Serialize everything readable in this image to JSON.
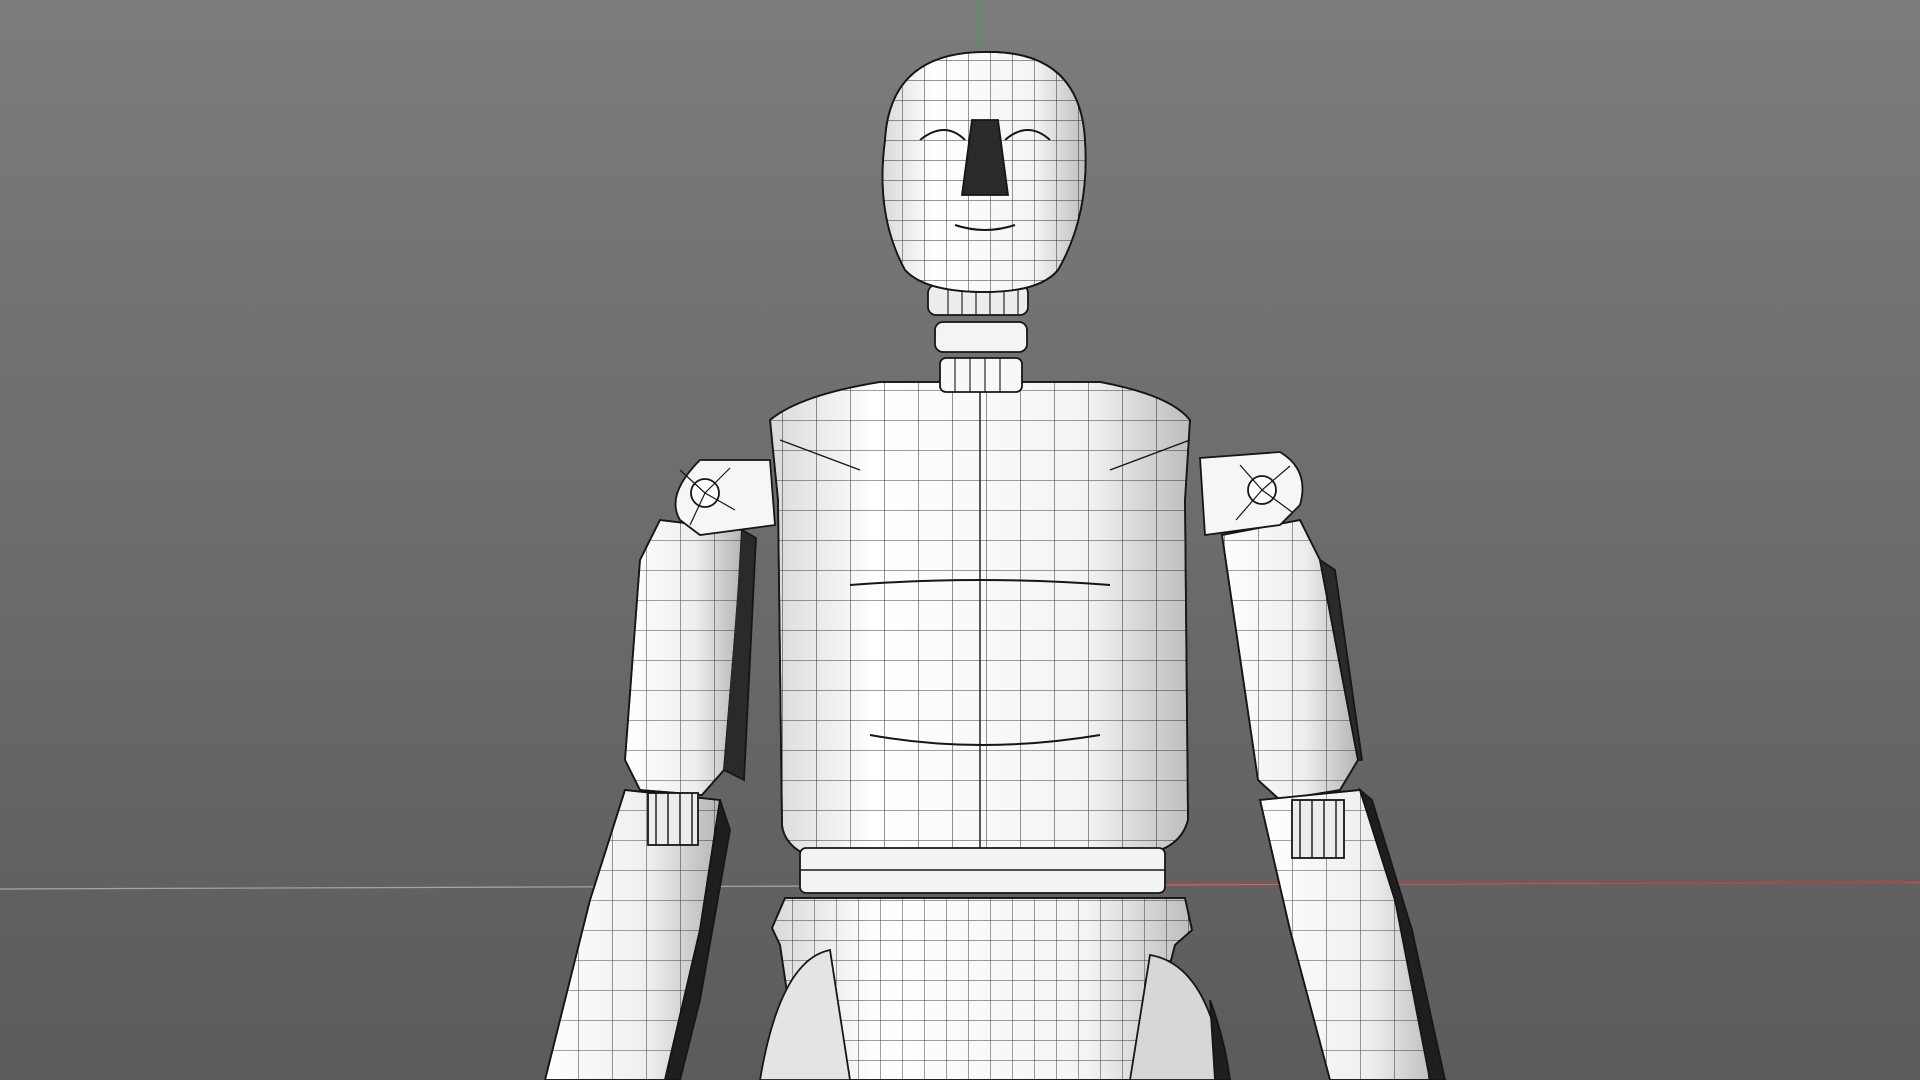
{
  "viewport": {
    "background_top": "#7d7d7d",
    "background_bottom": "#5c5c5c",
    "horizon_color": "#a9a9a9",
    "x_axis_color": "#c23b3b",
    "y_axis_color": "#3aa83a",
    "mesh_fill": "#f2f2f2",
    "mesh_shade": "#c9c9c9",
    "wire_color": "#1a1a1a",
    "model": "wireframe-mannequin"
  }
}
